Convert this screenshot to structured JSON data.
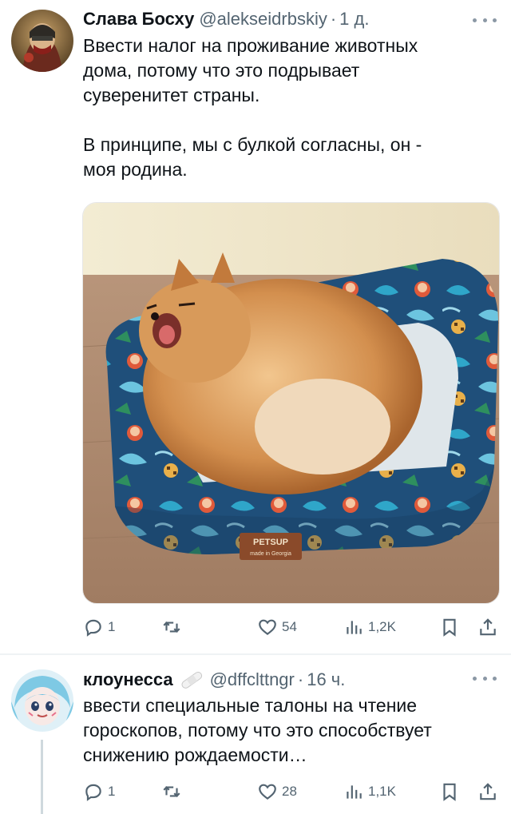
{
  "tweets": [
    {
      "display_name": "Слава Босху",
      "handle": "@alekseidrbskiy",
      "separator": "·",
      "time": "1 д.",
      "text": "Ввести налог на проживание животных\nдома, потому что это подрывает\nсуверенитет страны.\n\nВ принципе, мы с булкой согласны, он -\nмоя родина.",
      "media": {
        "label_brand": "PETSUP",
        "label_sub": "made in Georgia"
      },
      "actions": {
        "replies": "1",
        "retweets": "",
        "likes": "54",
        "views": "1,2K"
      }
    },
    {
      "display_name": "клоунесса",
      "handle": "@dffclttngr",
      "separator": "·",
      "time": "16 ч.",
      "text": "ввести специальные талоны на чтение\nгороскопов, потому что это способствует\nснижению рождаемости…",
      "actions": {
        "replies": "1",
        "retweets": "",
        "likes": "28",
        "views": "1,1K"
      }
    }
  ],
  "icons": {
    "more": "more-icon",
    "reply": "reply-icon",
    "retweet": "retweet-icon",
    "like": "heart-icon",
    "views": "views-icon",
    "bookmark": "bookmark-icon",
    "share": "share-icon"
  },
  "colors": {
    "text": "#0f1419",
    "secondary": "#536471",
    "divider": "#eff3f4"
  }
}
